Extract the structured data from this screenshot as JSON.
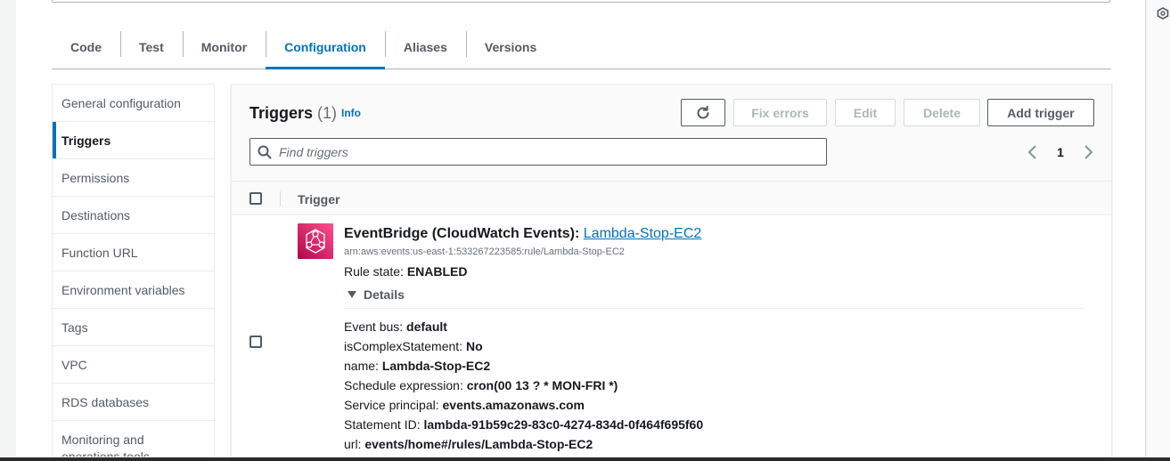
{
  "tabs": [
    {
      "label": "Code"
    },
    {
      "label": "Test"
    },
    {
      "label": "Monitor"
    },
    {
      "label": "Configuration"
    },
    {
      "label": "Aliases"
    },
    {
      "label": "Versions"
    }
  ],
  "active_tab": "Configuration",
  "sidenav": {
    "items": [
      {
        "label": "General configuration"
      },
      {
        "label": "Triggers"
      },
      {
        "label": "Permissions"
      },
      {
        "label": "Destinations"
      },
      {
        "label": "Function URL"
      },
      {
        "label": "Environment variables"
      },
      {
        "label": "Tags"
      },
      {
        "label": "VPC"
      },
      {
        "label": "RDS databases"
      },
      {
        "label": "Monitoring and operations tools"
      }
    ],
    "active": "Triggers"
  },
  "panel": {
    "title": "Triggers",
    "count": "(1)",
    "info_label": "Info",
    "buttons": {
      "fix_errors": "Fix errors",
      "edit": "Edit",
      "delete": "Delete",
      "add_trigger": "Add trigger"
    },
    "search_placeholder": "Find triggers",
    "page_number": "1",
    "column_header": "Trigger"
  },
  "trigger": {
    "source": "EventBridge (CloudWatch Events)",
    "separator": ":",
    "rule_name": "Lambda-Stop-EC2",
    "arn": "arn:aws:events:us-east-1:533267223585:rule/Lambda-Stop-EC2",
    "rule_state_label": "Rule state:",
    "rule_state_value": "ENABLED",
    "details_label": "Details",
    "details": [
      {
        "label": "Event bus:",
        "value": "default"
      },
      {
        "label": "isComplexStatement:",
        "value": "No"
      },
      {
        "label": "name:",
        "value": "Lambda-Stop-EC2"
      },
      {
        "label": "Schedule expression:",
        "value": "cron(00 13 ? * MON-FRI *)"
      },
      {
        "label": "Service principal:",
        "value": "events.amazonaws.com"
      },
      {
        "label": "Statement ID:",
        "value": "lambda-91b59c29-83c0-4274-834d-0f464f695f60"
      },
      {
        "label": "url:",
        "value": "events/home#/rules/Lambda-Stop-EC2"
      }
    ]
  },
  "colors": {
    "accent": "#0073bb",
    "text": "#16191f",
    "muted": "#545b64",
    "eventbridge_gradient_start": "#b0084d",
    "eventbridge_gradient_end": "#ff4f8b"
  }
}
